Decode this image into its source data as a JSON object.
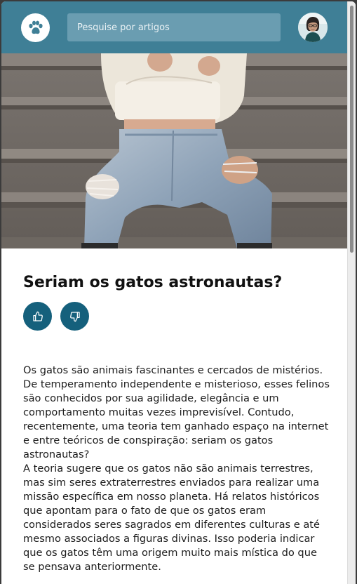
{
  "header": {
    "logo_icon": "paw-icon",
    "search_placeholder": "Pesquise por artigos",
    "avatar": "user-avatar"
  },
  "colors": {
    "header_bg": "#3f7f96",
    "search_bg": "#6a9db1",
    "vote_button_bg": "#15607c"
  },
  "article": {
    "hero_image": "woman-sitting-on-stairs-ripped-jeans-photo",
    "title": "Seriam os gatos astronautas?",
    "like_icon": "thumbs-up-icon",
    "dislike_icon": "thumbs-down-icon",
    "paragraphs": [
      "Os gatos são animais fascinantes e cercados de mistérios. De temperamento independente e misterioso, esses felinos são conhecidos por sua agilidade, elegância e um comportamento muitas vezes imprevisível. Contudo, recentemente, uma teoria tem ganhado espaço na internet e entre teóricos de conspiração: seriam os gatos astronautas?",
      "A teoria sugere que os gatos não são animais terrestres, mas sim seres extraterrestres enviados para realizar uma missão específica em nosso planeta. Há relatos históricos que apontam para o fato de que os gatos eram considerados seres sagrados em diferentes culturas e até mesmo associados a figuras divinas. Isso poderia indicar que os gatos têm uma origem muito mais mística do que se pensava anteriormente."
    ]
  }
}
